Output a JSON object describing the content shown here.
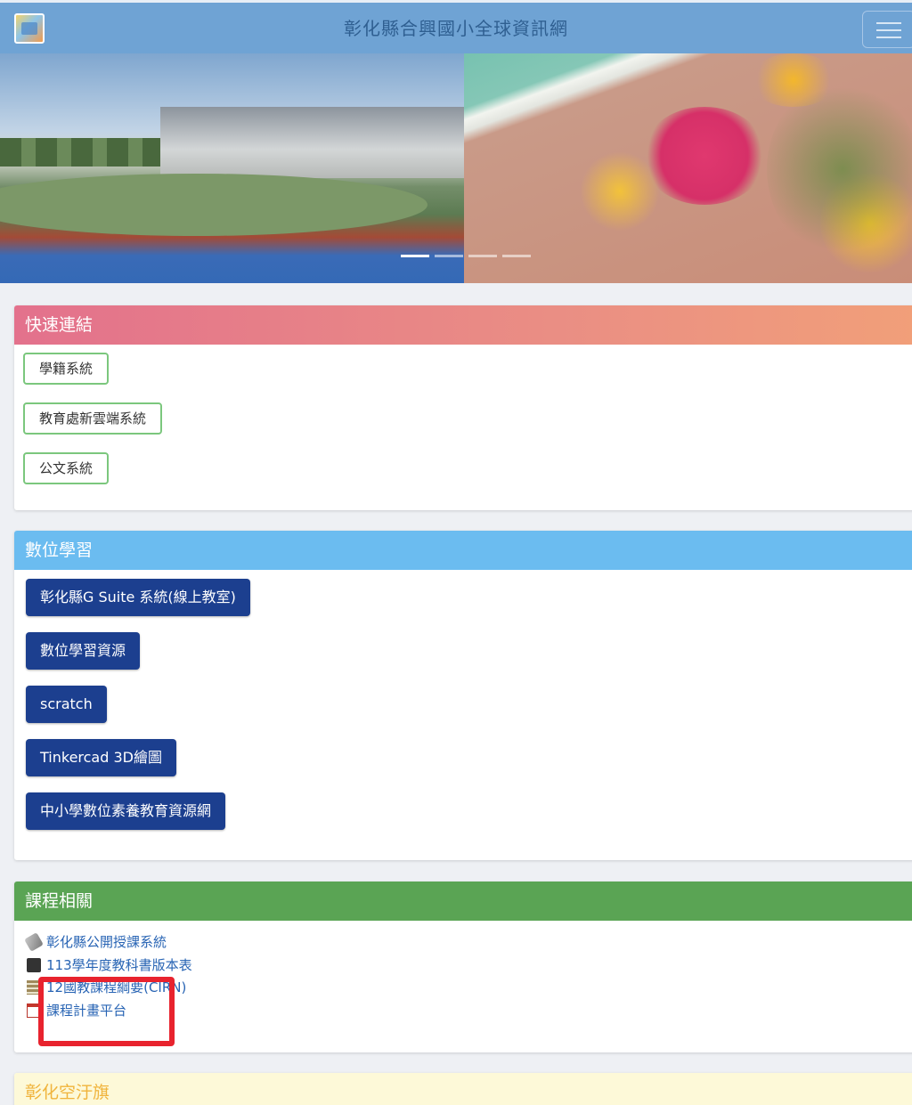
{
  "header": {
    "site_title": "彰化縣合興國小全球資訊網",
    "logo_icon": "school-logo-icon",
    "menu_icon": "hamburger-menu-icon"
  },
  "banner": {
    "slides_count": 4,
    "active_slide": 1
  },
  "quick_links": {
    "title": "快速連結",
    "items": [
      {
        "label": "學籍系統"
      },
      {
        "label": "教育處新雲端系統"
      },
      {
        "label": "公文系統"
      }
    ]
  },
  "digital_learning": {
    "title": "數位學習",
    "items": [
      {
        "label": "彰化縣G Suite 系統(線上教室)"
      },
      {
        "label": "數位學習資源"
      },
      {
        "label": "scratch"
      },
      {
        "label": "Tinkercad 3D繪圖"
      },
      {
        "label": "中小學數位素養教育資源網"
      }
    ]
  },
  "curriculum": {
    "title": "課程相關",
    "links": [
      {
        "icon": "tag-icon",
        "label": "彰化縣公開授課系統"
      },
      {
        "icon": "book-icon",
        "label": "113學年度教科書版本表"
      },
      {
        "icon": "spreadsheet-icon",
        "label": "12國教課程綱要(CIRN)"
      },
      {
        "icon": "calendar-icon",
        "label": "課程計畫平台"
      }
    ]
  },
  "next_section": {
    "title": "彰化空汙旗"
  },
  "colors": {
    "topbar": "#6fa3d4",
    "quick_links_head": "#e3718c",
    "digital_head": "#6bbcf0",
    "curriculum_head": "#5aa454",
    "solid_button": "#1c3f8f",
    "highlight": "#e8232e"
  }
}
